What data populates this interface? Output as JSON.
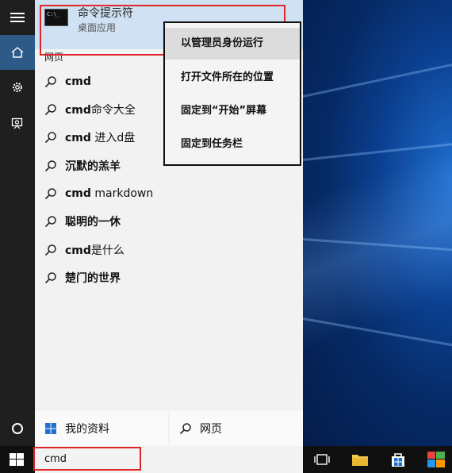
{
  "best_match": {
    "title": "命令提示符",
    "subtitle": "桌面应用"
  },
  "section_label": "网页",
  "results": [
    {
      "bold": "cmd",
      "rest": ""
    },
    {
      "bold": "cmd",
      "rest": "命令大全"
    },
    {
      "bold": "cmd",
      "rest": " 进入d盘"
    },
    {
      "bold": "沉默的羔羊",
      "rest": ""
    },
    {
      "bold": "cmd",
      "rest": " markdown"
    },
    {
      "bold": "聪明的一休",
      "rest": ""
    },
    {
      "bold": "cmd",
      "rest": "是什么"
    },
    {
      "bold": "楚门的世界",
      "rest": ""
    }
  ],
  "context_menu": [
    "以管理员身份运行",
    "打开文件所在的位置",
    "固定到“开始”屏幕",
    "固定到任务栏"
  ],
  "bottom": {
    "my_stuff": "我的资料",
    "web": "网页"
  },
  "search": {
    "query": "cmd"
  },
  "colors": {
    "highlight": "#cfe1f3",
    "annotation": "#e0262b",
    "rail_selected": "#2d5a86"
  }
}
